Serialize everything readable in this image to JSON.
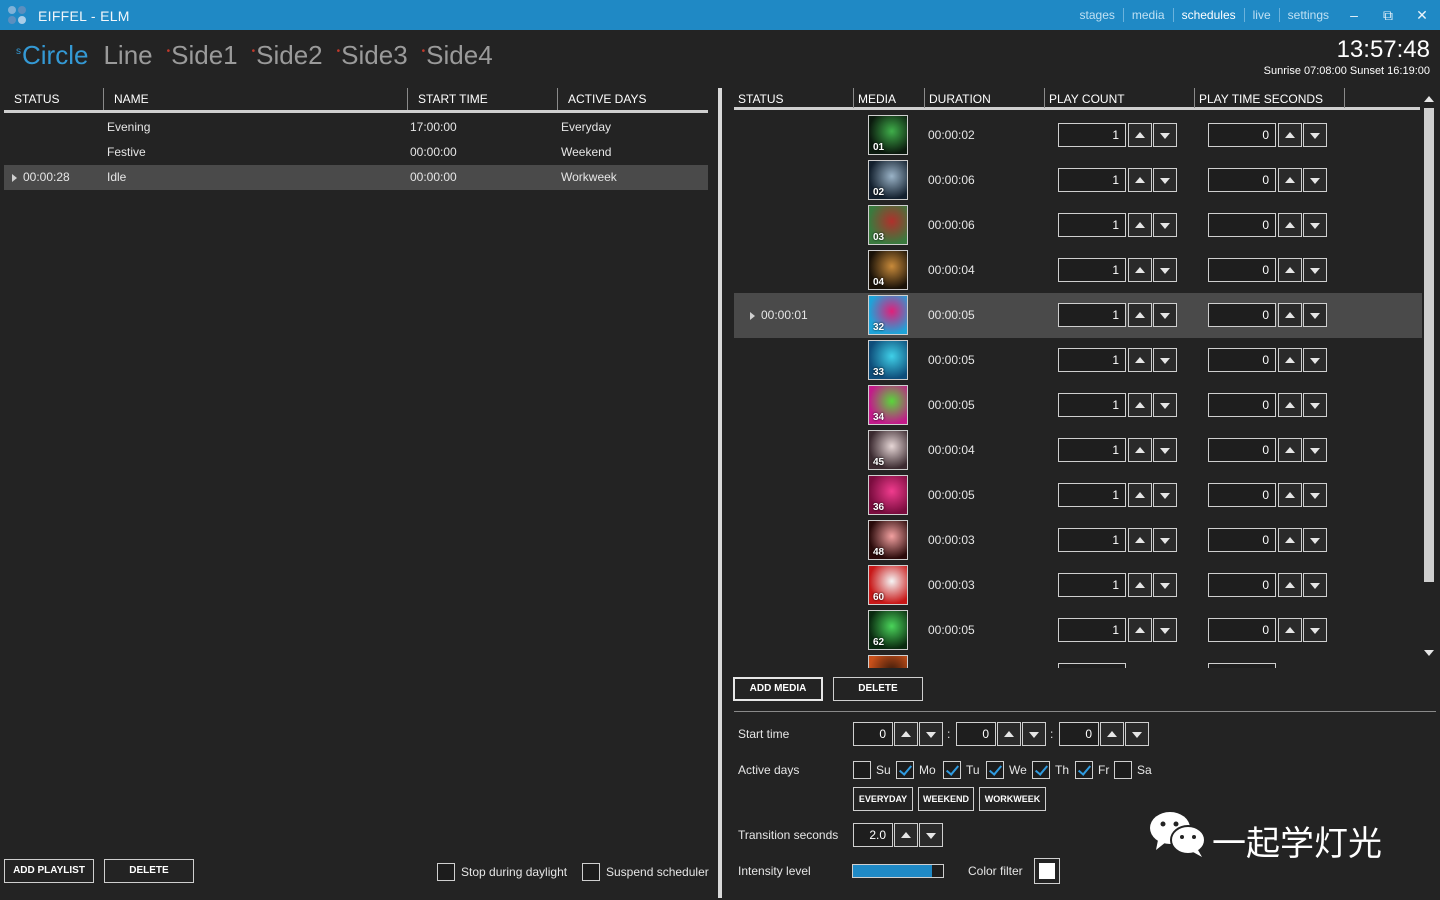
{
  "app": {
    "title": "EIFFEL - ELM",
    "nav": [
      "stages",
      "media",
      "schedules",
      "live",
      "settings"
    ],
    "active_nav": "schedules",
    "window_controls": {
      "minimize": "–",
      "restore": "⧉",
      "close": "✕"
    }
  },
  "stages": {
    "tabs": [
      {
        "prefix": "s",
        "label": "Circle"
      },
      {
        "prefix": "",
        "label": "Line"
      },
      {
        "prefix": "•",
        "label": "Side1"
      },
      {
        "prefix": "•",
        "label": "Side2"
      },
      {
        "prefix": "•",
        "label": "Side3"
      },
      {
        "prefix": "•",
        "label": "Side4"
      }
    ],
    "active": "Circle"
  },
  "clock": {
    "time": "13:57:48",
    "sun": "Sunrise 07:08:00  Sunset 16:19:00"
  },
  "playlists": {
    "headers": {
      "status": "STATUS",
      "name": "NAME",
      "start_time": "START TIME",
      "active_days": "ACTIVE DAYS"
    },
    "rows": [
      {
        "status": "",
        "name": "Evening",
        "start_time": "17:00:00",
        "active_days": "Everyday",
        "selected": false
      },
      {
        "status": "",
        "name": "Festive",
        "start_time": "00:00:00",
        "active_days": "Weekend",
        "selected": false
      },
      {
        "status": "00:00:28",
        "name": "Idle",
        "start_time": "00:00:00",
        "active_days": "Workweek",
        "selected": true
      }
    ],
    "add_label": "ADD PLAYLIST",
    "delete_label": "DELETE",
    "stop_daylight_label": "Stop during daylight",
    "stop_daylight_checked": false,
    "suspend_label": "Suspend scheduler",
    "suspend_checked": false
  },
  "media": {
    "headers": {
      "status": "STATUS",
      "media": "MEDIA",
      "duration": "DURATION",
      "play_count": "PLAY COUNT",
      "play_time": "PLAY TIME SECONDS"
    },
    "rows": [
      {
        "status": "",
        "num": "01",
        "duration": "00:00:02",
        "count": "1",
        "seconds": "0",
        "c1": "#0b1a0e",
        "c2": "#3fae4a"
      },
      {
        "status": "",
        "num": "02",
        "duration": "00:00:06",
        "count": "1",
        "seconds": "0",
        "c1": "#13202e",
        "c2": "#9ab3c7"
      },
      {
        "status": "",
        "num": "03",
        "duration": "00:00:06",
        "count": "1",
        "seconds": "0",
        "c1": "#3a7a3e",
        "c2": "#b0302c"
      },
      {
        "status": "",
        "num": "04",
        "duration": "00:00:04",
        "count": "1",
        "seconds": "0",
        "c1": "#1a1208",
        "c2": "#c88a3a"
      },
      {
        "status": "00:00:01",
        "num": "32",
        "duration": "00:00:05",
        "count": "1",
        "seconds": "0",
        "c1": "#1fa3d8",
        "c2": "#e0207a",
        "selected": true
      },
      {
        "status": "",
        "num": "33",
        "duration": "00:00:05",
        "count": "1",
        "seconds": "0",
        "c1": "#0e4d7a",
        "c2": "#3fd0e8"
      },
      {
        "status": "",
        "num": "34",
        "duration": "00:00:05",
        "count": "1",
        "seconds": "0",
        "c1": "#c21b8a",
        "c2": "#59d63a"
      },
      {
        "status": "",
        "num": "45",
        "duration": "00:00:04",
        "count": "1",
        "seconds": "0",
        "c1": "#3b2a30",
        "c2": "#e6d6d6"
      },
      {
        "status": "",
        "num": "36",
        "duration": "00:00:05",
        "count": "1",
        "seconds": "0",
        "c1": "#7a0c3e",
        "c2": "#f03c8e"
      },
      {
        "status": "",
        "num": "48",
        "duration": "00:00:03",
        "count": "1",
        "seconds": "0",
        "c1": "#2a0a0a",
        "c2": "#f2a0a0"
      },
      {
        "status": "",
        "num": "60",
        "duration": "00:00:03",
        "count": "1",
        "seconds": "0",
        "c1": "#c81818",
        "c2": "#f5f5f5"
      },
      {
        "status": "",
        "num": "62",
        "duration": "00:00:05",
        "count": "1",
        "seconds": "0",
        "c1": "#0a2a10",
        "c2": "#4ad45a"
      },
      {
        "status": "",
        "num": "",
        "duration": "",
        "count": "",
        "seconds": "",
        "c1": "#c8501a",
        "c2": "#3a1a0a"
      }
    ],
    "add_label": "ADD MEDIA",
    "delete_label": "DELETE"
  },
  "schedule": {
    "start_time_label": "Start time",
    "start_h": "0",
    "start_m": "0",
    "start_s": "0",
    "colon": ":",
    "active_days_label": "Active days",
    "days": [
      {
        "label": "Su",
        "checked": false
      },
      {
        "label": "Mo",
        "checked": true
      },
      {
        "label": "Tu",
        "checked": true
      },
      {
        "label": "We",
        "checked": true
      },
      {
        "label": "Th",
        "checked": true
      },
      {
        "label": "Fr",
        "checked": true
      },
      {
        "label": "Sa",
        "checked": false
      }
    ],
    "preset_everyday": "EVERYDAY",
    "preset_weekend": "WEEKEND",
    "preset_workweek": "WORKWEEK",
    "transition_label": "Transition seconds",
    "transition_value": "2.0",
    "intensity_label": "Intensity level",
    "intensity_value": 0.88,
    "color_filter_label": "Color filter",
    "color_filter_value": "#ffffff"
  },
  "watermark": {
    "text": "一起学灯光"
  }
}
